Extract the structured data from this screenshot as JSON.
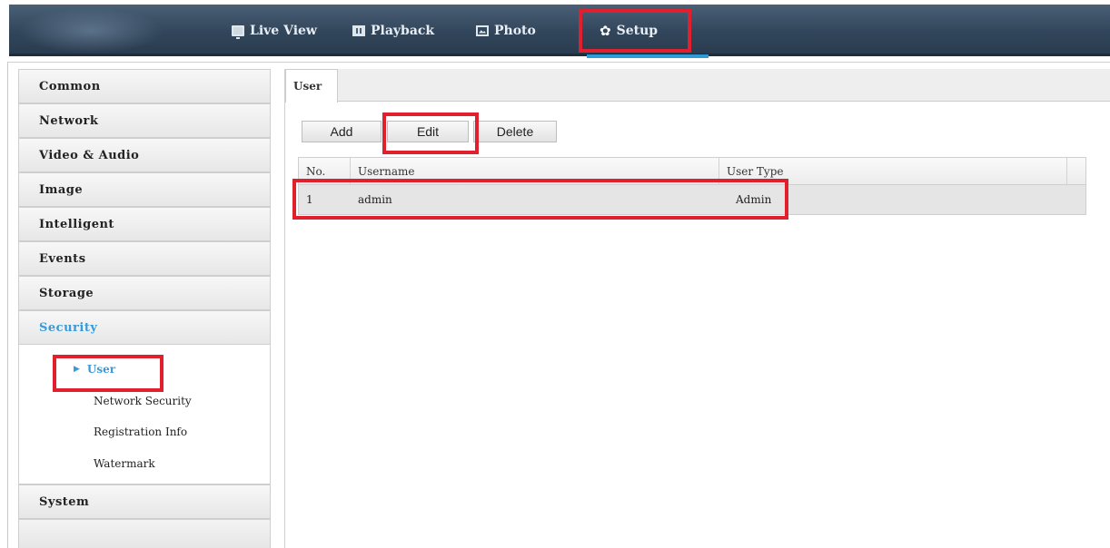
{
  "nav": {
    "items": [
      {
        "label": "Live View",
        "icon": "monitor-icon"
      },
      {
        "label": "Playback",
        "icon": "playback-icon"
      },
      {
        "label": "Photo",
        "icon": "photo-icon"
      },
      {
        "label": "Setup",
        "icon": "gear-icon",
        "active": true
      }
    ]
  },
  "sidebar": {
    "items": [
      "Common",
      "Network",
      "Video & Audio",
      "Image",
      "Intelligent",
      "Events",
      "Storage",
      "Security"
    ],
    "security_sub": [
      "User",
      "Network Security",
      "Registration Info",
      "Watermark"
    ],
    "after": [
      "System"
    ]
  },
  "content": {
    "tab": "User",
    "buttons": {
      "add": "Add",
      "edit": "Edit",
      "delete": "Delete"
    },
    "table": {
      "headers": [
        "No.",
        "Username",
        "User Type"
      ],
      "rows": [
        {
          "no": "1",
          "username": "admin",
          "type": "Admin"
        }
      ]
    }
  },
  "colors": {
    "accent": "#3a9ad6",
    "highlight": "#e0202c",
    "nav_bg": "#32465b"
  }
}
